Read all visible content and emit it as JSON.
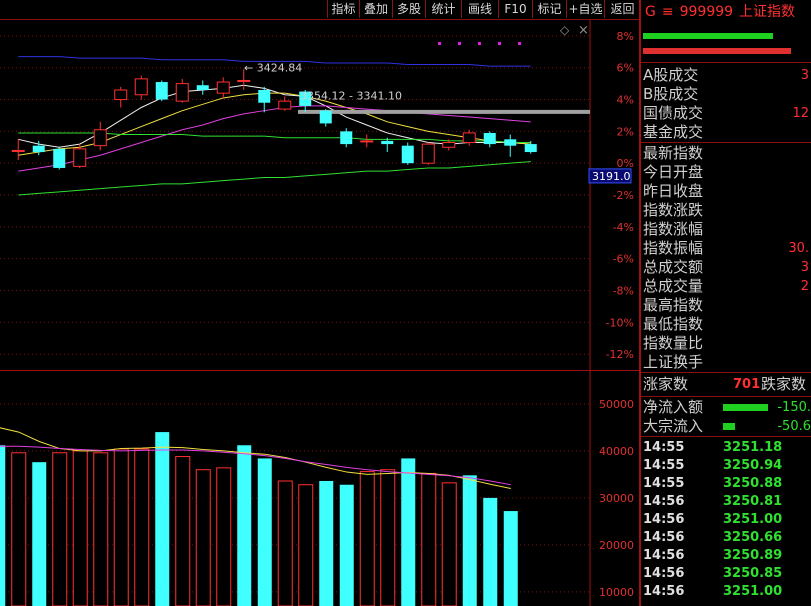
{
  "toolbar": {
    "buttons": [
      "指标",
      "叠加",
      "多股",
      "统计",
      "画线",
      "F10",
      "标记",
      "+自选",
      "返回"
    ],
    "icons": [
      "close-icon",
      "diamond-icon"
    ]
  },
  "quote": {
    "prefix": "G",
    "symbol": "≡",
    "code": "999999",
    "name": "上证指数"
  },
  "info": [
    {
      "label": "A股成交",
      "value": "3"
    },
    {
      "label": "B股成交",
      "value": ""
    },
    {
      "label": "国债成交",
      "value": "12"
    },
    {
      "label": "基金成交",
      "value": ""
    },
    {
      "label": "最新指数",
      "value": ""
    },
    {
      "label": "今日开盘",
      "value": ""
    },
    {
      "label": "昨日收盘",
      "value": ""
    },
    {
      "label": "指数涨跌",
      "value": ""
    },
    {
      "label": "指数涨幅",
      "value": ""
    },
    {
      "label": "指数振幅",
      "value": "30."
    },
    {
      "label": "总成交额",
      "value": "3"
    },
    {
      "label": "总成交量",
      "value": "2"
    },
    {
      "label": "最高指数",
      "value": ""
    },
    {
      "label": "最低指数",
      "value": ""
    },
    {
      "label": "指数量比",
      "value": ""
    },
    {
      "label": "上证换手",
      "value": ""
    }
  ],
  "breadth": {
    "up_label": "涨家数",
    "up_value": "701",
    "down_label": "跌家数"
  },
  "flows": [
    {
      "label": "净流入额",
      "value": "-150.",
      "fill": 0.75
    },
    {
      "label": "大宗流入",
      "value": "-50.6",
      "fill": 0.2
    }
  ],
  "ticks": [
    {
      "time": "14:55",
      "price": "3251.18"
    },
    {
      "time": "14:55",
      "price": "3250.94"
    },
    {
      "time": "14:55",
      "price": "3250.88"
    },
    {
      "time": "14:56",
      "price": "3250.81"
    },
    {
      "time": "14:56",
      "price": "3251.00"
    },
    {
      "time": "14:56",
      "price": "3250.66"
    },
    {
      "time": "14:56",
      "price": "3250.89"
    },
    {
      "time": "14:56",
      "price": "3250.85"
    },
    {
      "time": "14:56",
      "price": "3251.00"
    }
  ],
  "colors": {
    "up": "#ff3030",
    "down": "#40ffff",
    "grid": "#7a1010",
    "ma5": "#f0f0f0",
    "ma10": "#f0e040",
    "ma20": "#e040e0",
    "ma60": "#30e030",
    "ma120": "#3030e0"
  },
  "chart_data": {
    "type": "bar",
    "price": {
      "y_axis_pct": [
        "8%",
        "6%",
        "4%",
        "2%",
        "0%",
        "-2%",
        "-4%",
        "-6%",
        "-8%",
        "-10%",
        "-12%"
      ],
      "ylim_pct": [
        -13,
        9
      ],
      "current_label": "3191.0",
      "high_label": "3424.84",
      "range_label": "3354.12 - 3341.10",
      "candles": [
        {
          "o": 0.8,
          "c": 0.8,
          "h": 1.5,
          "l": 0.2
        },
        {
          "o": 1.1,
          "c": 0.7,
          "h": 1.4,
          "l": 0.5
        },
        {
          "o": 0.9,
          "c": -0.3,
          "h": 1.0,
          "l": -0.4
        },
        {
          "o": -0.2,
          "c": 0.9,
          "h": 1.2,
          "l": -0.3
        },
        {
          "o": 1.1,
          "c": 2.1,
          "h": 2.6,
          "l": 0.8
        },
        {
          "o": 4.0,
          "c": 4.6,
          "h": 4.8,
          "l": 3.5
        },
        {
          "o": 4.3,
          "c": 5.3,
          "h": 5.5,
          "l": 4.0
        },
        {
          "o": 5.1,
          "c": 4.0,
          "h": 5.2,
          "l": 3.9
        },
        {
          "o": 3.9,
          "c": 5.0,
          "h": 5.3,
          "l": 3.8
        },
        {
          "o": 4.9,
          "c": 4.6,
          "h": 5.2,
          "l": 4.3
        },
        {
          "o": 4.4,
          "c": 5.1,
          "h": 5.4,
          "l": 4.1
        },
        {
          "o": 5.2,
          "c": 5.2,
          "h": 5.9,
          "l": 4.6
        },
        {
          "o": 4.6,
          "c": 3.8,
          "h": 4.8,
          "l": 3.2
        },
        {
          "o": 3.4,
          "c": 3.9,
          "h": 4.2,
          "l": 3.3
        },
        {
          "o": 4.5,
          "c": 3.6,
          "h": 4.6,
          "l": 3.2
        },
        {
          "o": 3.3,
          "c": 2.5,
          "h": 3.4,
          "l": 2.3
        },
        {
          "o": 2.0,
          "c": 1.2,
          "h": 2.2,
          "l": 1.0
        },
        {
          "o": 1.4,
          "c": 1.4,
          "h": 1.8,
          "l": 1.0
        },
        {
          "o": 1.4,
          "c": 1.2,
          "h": 1.6,
          "l": 0.7
        },
        {
          "o": 1.1,
          "c": 0.0,
          "h": 1.3,
          "l": -0.1
        },
        {
          "o": 0.0,
          "c": 1.2,
          "h": 1.3,
          "l": -0.1
        },
        {
          "o": 1.0,
          "c": 1.3,
          "h": 1.5,
          "l": 0.8
        },
        {
          "o": 1.3,
          "c": 1.9,
          "h": 2.1,
          "l": 1.1
        },
        {
          "o": 1.9,
          "c": 1.2,
          "h": 2.0,
          "l": 1.0
        },
        {
          "o": 1.5,
          "c": 1.1,
          "h": 1.8,
          "l": 0.4
        },
        {
          "o": 1.2,
          "c": 0.7,
          "h": 1.4,
          "l": 0.6
        }
      ],
      "ma_lines": [
        {
          "name": "ma5",
          "values": [
            1.5,
            1.2,
            1.0,
            1.2,
            1.9,
            2.7,
            3.5,
            4.1,
            4.5,
            4.6,
            4.7,
            4.9,
            4.7,
            4.3,
            4.2,
            3.6,
            2.9,
            2.4,
            1.9,
            1.6,
            1.3,
            1.2,
            1.3,
            1.3,
            1.3,
            1.2
          ]
        },
        {
          "name": "ma10",
          "values": [
            0.5,
            0.7,
            0.9,
            1.0,
            1.3,
            1.8,
            2.3,
            2.8,
            3.3,
            3.7,
            4.1,
            4.3,
            4.4,
            4.4,
            4.2,
            3.9,
            3.5,
            3.1,
            2.6,
            2.3,
            2.0,
            1.8,
            1.6,
            1.4,
            1.3,
            1.2
          ]
        },
        {
          "name": "ma20",
          "values": [
            -0.5,
            -0.3,
            -0.1,
            0.2,
            0.5,
            0.9,
            1.3,
            1.7,
            2.1,
            2.4,
            2.8,
            3.1,
            3.3,
            3.5,
            3.6,
            3.6,
            3.5,
            3.4,
            3.3,
            3.2,
            3.1,
            3.0,
            2.9,
            2.8,
            2.7,
            2.6
          ]
        },
        {
          "name": "ma60",
          "values": [
            1.9,
            1.9,
            1.9,
            1.9,
            1.9,
            1.8,
            1.8,
            1.8,
            1.8,
            1.7,
            1.7,
            1.7,
            1.7,
            1.6,
            1.6,
            1.6,
            1.6,
            1.5,
            1.5,
            1.5,
            1.5,
            1.4,
            1.4,
            1.4,
            1.3,
            1.3
          ]
        },
        {
          "name": "ma120",
          "values": [
            -2.0,
            -1.9,
            -1.8,
            -1.7,
            -1.6,
            -1.5,
            -1.4,
            -1.3,
            -1.3,
            -1.2,
            -1.1,
            -1.0,
            -0.9,
            -0.9,
            -0.8,
            -0.7,
            -0.6,
            -0.5,
            -0.5,
            -0.4,
            -0.3,
            -0.3,
            -0.2,
            -0.1,
            0.0,
            0.1
          ]
        },
        {
          "name": "ma250",
          "values": [
            6.7,
            6.7,
            6.7,
            6.6,
            6.6,
            6.6,
            6.6,
            6.5,
            6.5,
            6.5,
            6.5,
            6.4,
            6.4,
            6.4,
            6.4,
            6.3,
            6.3,
            6.3,
            6.3,
            6.2,
            6.2,
            6.2,
            6.2,
            6.1,
            6.1,
            6.1
          ]
        }
      ]
    },
    "volume": {
      "y_ticks": [
        "50000",
        "40000",
        "30000",
        "20000",
        "10000"
      ],
      "ylim": [
        7000,
        57000
      ],
      "values": [
        41200,
        39600,
        37600,
        39600,
        40000,
        39600,
        40400,
        40400,
        44000,
        38800,
        36000,
        36400,
        41200,
        38400,
        33600,
        32800,
        33600,
        32800,
        35600,
        36000,
        38400,
        35200,
        33200,
        34800,
        30000,
        27200
      ],
      "up": [
        false,
        true,
        false,
        true,
        true,
        true,
        true,
        true,
        false,
        true,
        true,
        true,
        false,
        false,
        true,
        true,
        false,
        false,
        true,
        true,
        false,
        true,
        true,
        false,
        false,
        false
      ],
      "ma_lines": [
        {
          "name": "vma5",
          "values": [
            45000,
            44000,
            42000,
            40500,
            40000,
            40000,
            40500,
            40600,
            40800,
            40700,
            40300,
            40000,
            39600,
            39300,
            38600,
            37600,
            36500,
            35500,
            35000,
            35200,
            35400,
            35200,
            34800,
            33900,
            32900,
            32000
          ]
        },
        {
          "name": "vma10",
          "values": [
            41000,
            41000,
            40800,
            40500,
            40300,
            40100,
            40000,
            40100,
            40200,
            40200,
            40000,
            39700,
            39400,
            39000,
            38400,
            37700,
            37100,
            36500,
            36000,
            35600,
            35300,
            35000,
            34700,
            34300,
            33600,
            32800
          ]
        }
      ]
    }
  }
}
